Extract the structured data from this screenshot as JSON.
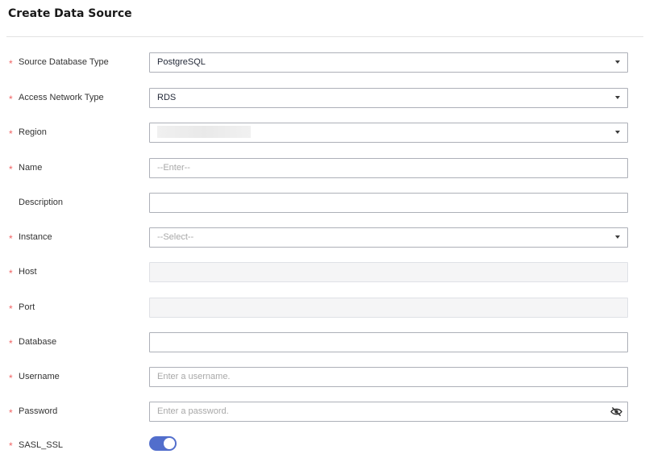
{
  "page": {
    "title": "Create Data Source"
  },
  "form": {
    "source_db_type": {
      "label": "Source Database Type",
      "value": "PostgreSQL"
    },
    "access_network_type": {
      "label": "Access Network Type",
      "value": "RDS"
    },
    "region": {
      "label": "Region",
      "value": ""
    },
    "name": {
      "label": "Name",
      "placeholder": "--Enter--"
    },
    "description": {
      "label": "Description",
      "value": ""
    },
    "instance": {
      "label": "Instance",
      "placeholder": "--Select--"
    },
    "host": {
      "label": "Host",
      "value": ""
    },
    "port": {
      "label": "Port",
      "value": ""
    },
    "database": {
      "label": "Database",
      "value": ""
    },
    "username": {
      "label": "Username",
      "placeholder": "Enter a username."
    },
    "password": {
      "label": "Password",
      "placeholder": "Enter a password."
    },
    "sasl_ssl": {
      "label": "SASL_SSL",
      "enabled": true
    }
  },
  "required_mark": "*",
  "colors": {
    "required": "#f06363",
    "toggle_on": "#526ecc",
    "border": "#adb0b8"
  },
  "icons": {
    "dropdown": "caret-down-icon",
    "password_toggle": "eye-off-icon"
  }
}
